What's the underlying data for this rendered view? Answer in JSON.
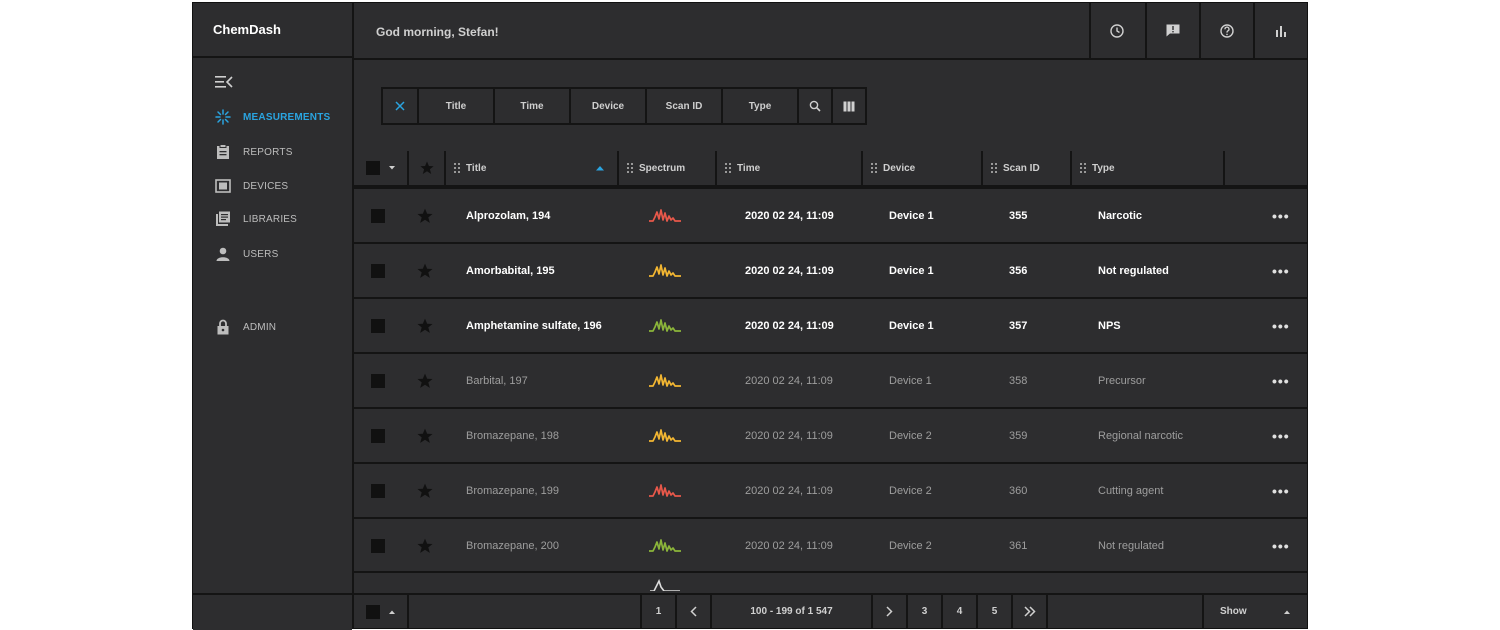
{
  "app": {
    "brand": "ChemDash"
  },
  "header": {
    "greeting": "God morning, Stefan!",
    "buttons": [
      {
        "name": "history",
        "icon": "clock-icon"
      },
      {
        "name": "feedback",
        "icon": "feedback-icon"
      },
      {
        "name": "help",
        "icon": "help-icon"
      },
      {
        "name": "stats",
        "icon": "bar-chart-icon"
      }
    ]
  },
  "sidebar": {
    "items": [
      {
        "label": "MEASUREMENTS",
        "icon": "spectrum-icon",
        "active": true
      },
      {
        "label": "REPORTS",
        "icon": "clipboard-icon",
        "active": false
      },
      {
        "label": "DEVICES",
        "icon": "device-icon",
        "active": false
      },
      {
        "label": "LIBRARIES",
        "icon": "library-icon",
        "active": false
      },
      {
        "label": "USERS",
        "icon": "user-icon",
        "active": false
      },
      {
        "label": "ADMIN",
        "icon": "lock-icon",
        "active": false
      }
    ]
  },
  "filters": {
    "labels": [
      "Title",
      "Time",
      "Device",
      "Scan ID",
      "Type"
    ]
  },
  "table": {
    "columns": [
      "Title",
      "Spectrum",
      "Time",
      "Device",
      "Scan ID",
      "Type"
    ],
    "sort_column": "Title",
    "rows": [
      {
        "title": "Alprozolam, 194",
        "spectrum_color": "#e8584a",
        "time": "2020 02 24, 11:09",
        "device": "Device 1",
        "scan_id": "355",
        "type": "Narcotic",
        "unread": true
      },
      {
        "title": "Amorbabital, 195",
        "spectrum_color": "#f2b632",
        "time": "2020 02 24, 11:09",
        "device": "Device 1",
        "scan_id": "356",
        "type": "Not regulated",
        "unread": true
      },
      {
        "title": "Amphetamine sulfate, 196",
        "spectrum_color": "#8bb53a",
        "time": "2020 02 24, 11:09",
        "device": "Device 1",
        "scan_id": "357",
        "type": "NPS",
        "unread": true
      },
      {
        "title": "Barbital, 197",
        "spectrum_color": "#f2b632",
        "time": "2020 02 24, 11:09",
        "device": "Device 1",
        "scan_id": "358",
        "type": "Precursor",
        "unread": false
      },
      {
        "title": "Bromazepane, 198",
        "spectrum_color": "#f2b632",
        "time": "2020 02 24, 11:09",
        "device": "Device 2",
        "scan_id": "359",
        "type": "Regional narcotic",
        "unread": false
      },
      {
        "title": "Bromazepane, 199",
        "spectrum_color": "#e8584a",
        "time": "2020 02 24, 11:09",
        "device": "Device 2",
        "scan_id": "360",
        "type": "Cutting agent",
        "unread": false
      },
      {
        "title": "Bromazepane, 200",
        "spectrum_color": "#8bb53a",
        "time": "2020 02 24, 11:09",
        "device": "Device 2",
        "scan_id": "361",
        "type": "Not regulated",
        "unread": false
      }
    ]
  },
  "pagination": {
    "first_page": "1",
    "range": "100 - 199 of 1 547",
    "pages": [
      "3",
      "4",
      "5"
    ],
    "show_label": "Show"
  },
  "colors": {
    "accent": "#2aa4e0",
    "panel": "#2d2d2f",
    "gutter": "#141414"
  }
}
